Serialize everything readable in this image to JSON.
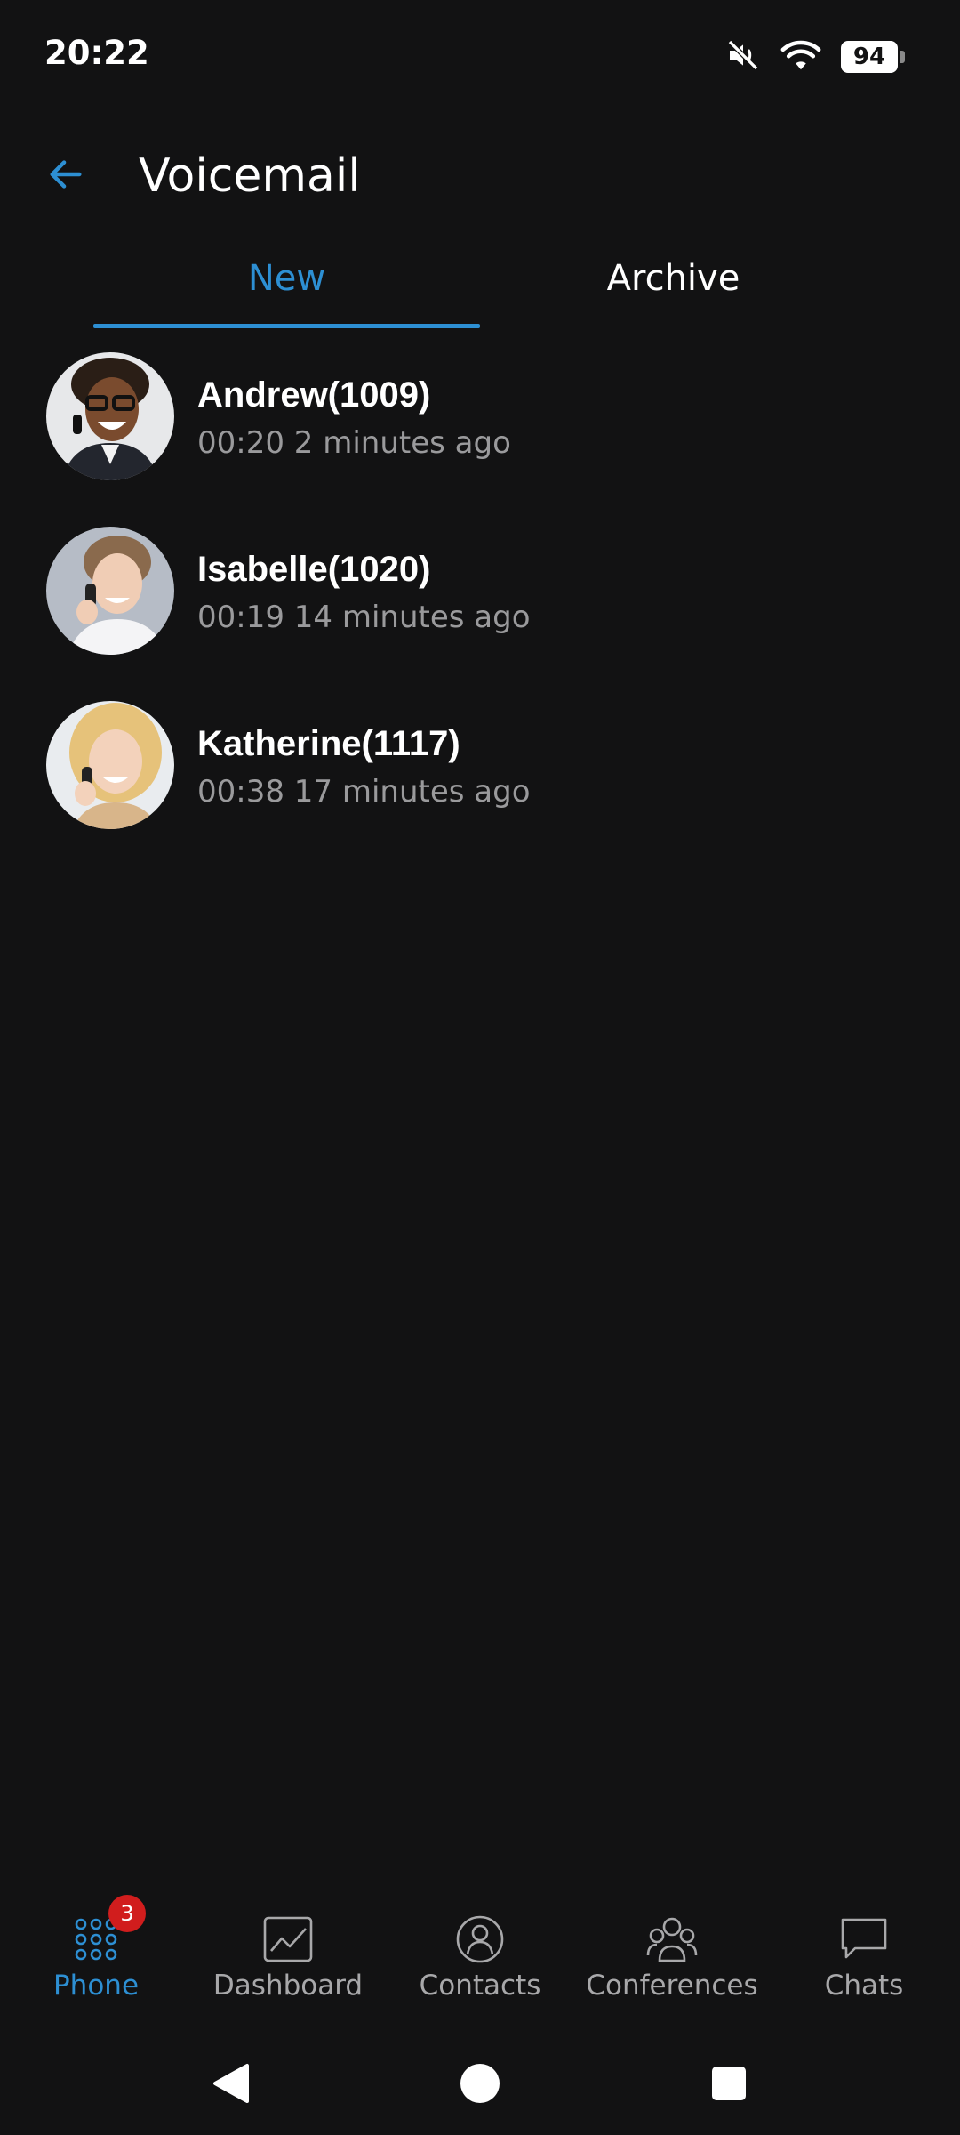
{
  "status_bar": {
    "time": "20:22",
    "battery": "94",
    "icons": [
      "mute-icon",
      "wifi-icon",
      "battery-icon"
    ]
  },
  "header": {
    "title": "Voicemail",
    "back_icon": "arrow-left-icon"
  },
  "tabs": [
    {
      "label": "New",
      "active": true
    },
    {
      "label": "Archive",
      "active": false
    }
  ],
  "voicemails": [
    {
      "name": "Andrew(1009)",
      "duration": "00:20",
      "time_ago": "2 minutes ago",
      "meta": "00:20 2 minutes ago"
    },
    {
      "name": "Isabelle(1020)",
      "duration": "00:19",
      "time_ago": "14 minutes ago",
      "meta": "00:19 14 minutes ago"
    },
    {
      "name": "Katherine(1117)",
      "duration": "00:38",
      "time_ago": "17 minutes ago",
      "meta": "00:38 17 minutes ago"
    }
  ],
  "bottom_nav": {
    "items": [
      {
        "label": "Phone",
        "icon": "dialpad-icon",
        "active": true,
        "badge": "3"
      },
      {
        "label": "Dashboard",
        "icon": "chart-icon",
        "active": false
      },
      {
        "label": "Contacts",
        "icon": "contact-icon",
        "active": false
      },
      {
        "label": "Conferences",
        "icon": "group-icon",
        "active": false
      },
      {
        "label": "Chats",
        "icon": "chat-icon",
        "active": false
      }
    ]
  },
  "colors": {
    "background": "#121213",
    "accent": "#2d8fd3",
    "text_primary": "#ffffff",
    "text_secondary": "#9a9a9c",
    "badge": "#d11d1d"
  }
}
